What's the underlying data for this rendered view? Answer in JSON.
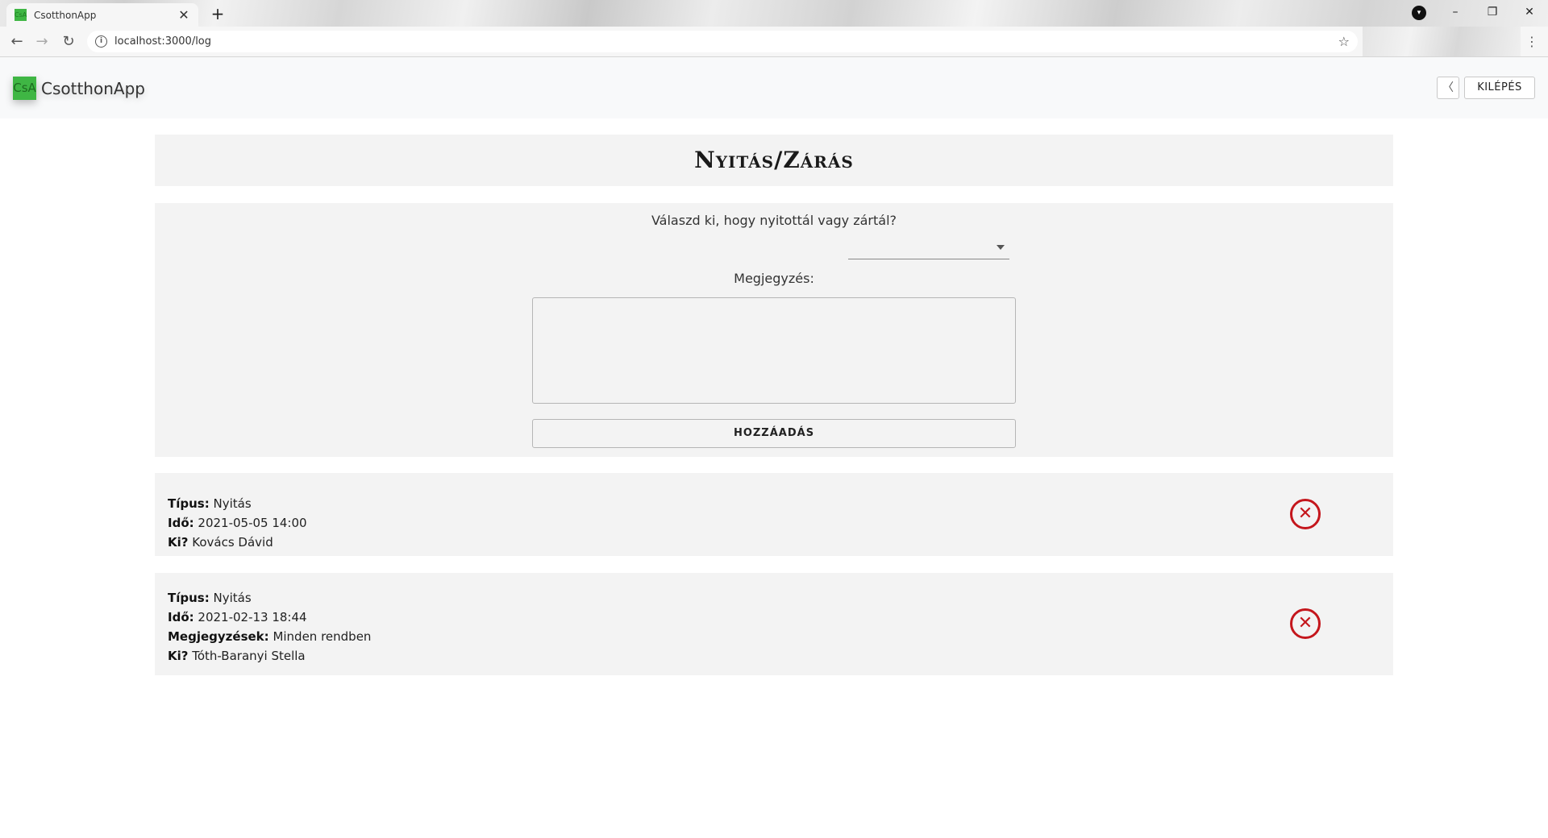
{
  "browser": {
    "tab_title": "CsotthonApp",
    "favicon_text": "CsA",
    "url": "localhost:3000/log",
    "icons": [
      "back-arrow-icon",
      "forward-arrow-icon",
      "reload-icon",
      "info-icon",
      "star-icon",
      "menu-icon",
      "close-icon",
      "plus-icon",
      "minimize-icon",
      "maximize-icon",
      "profile-icon"
    ]
  },
  "app": {
    "logo_text": "CsA",
    "name": "CsotthonApp",
    "back_label": "〈",
    "logout_label": "KILÉPÉS",
    "accent_color": "#3fb644"
  },
  "page": {
    "title": "Nyitás/Zárás"
  },
  "form": {
    "question": "Válaszd ki, hogy nyitottál vagy zártál?",
    "selected_value": "",
    "note_label": "Megjegyzés:",
    "note_value": "",
    "add_label": "HOZZÁADÁS"
  },
  "labels": {
    "type": "Típus:",
    "time": "Idő:",
    "notes": "Megjegyzések:",
    "who": "Ki?"
  },
  "entries": [
    {
      "type": "Nyitás",
      "time": "2021-05-05 14:00",
      "who": "Kovács Dávid"
    },
    {
      "type": "Nyitás",
      "time": "2021-02-13 18:44",
      "notes": "Minden rendben",
      "who": "Tóth-Baranyi Stella"
    }
  ],
  "delete_color": "#c4161c"
}
